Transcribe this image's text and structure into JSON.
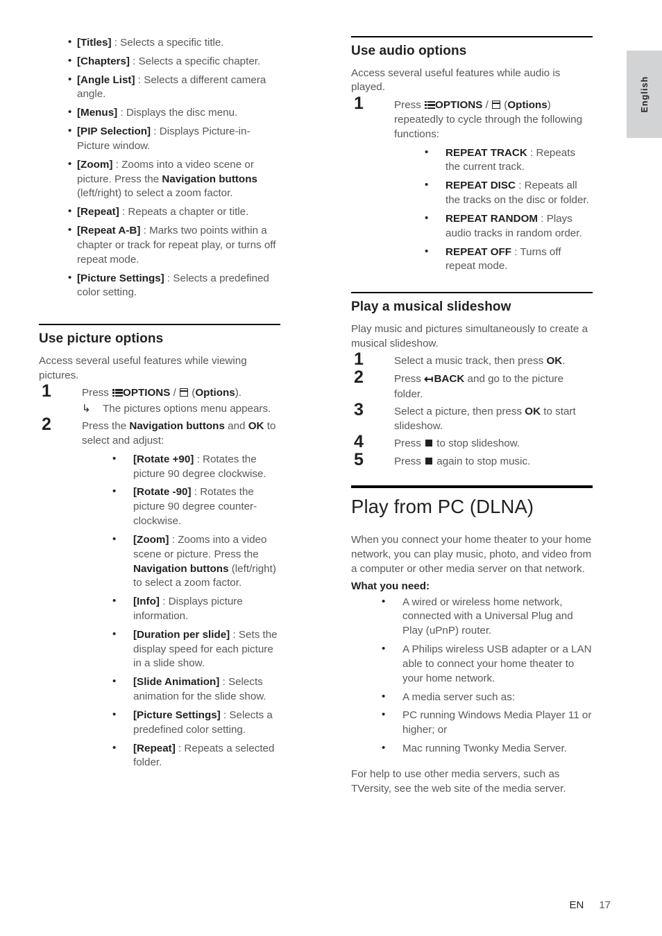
{
  "page": {
    "language_tab": "English",
    "footer_language_code": "EN",
    "footer_page_number": "17"
  },
  "left_column": {
    "video_options_bullets": [
      {
        "term": "[Titles]",
        "desc": " : Selects a specific title."
      },
      {
        "term": "[Chapters]",
        "desc": " : Selects a specific chapter."
      },
      {
        "term": "[Angle List]",
        "desc": " : Selects a different camera angle."
      },
      {
        "term": "[Menus]",
        "desc": " : Displays the disc menu."
      },
      {
        "term": "[PIP Selection]",
        "desc": " : Displays Picture-in-Picture window."
      },
      {
        "term": "[Zoom]",
        "desc_pre": " : Zooms into a video scene or picture. Press the ",
        "emphasis": "Navigation buttons",
        "desc_post": " (left/right) to select a zoom factor."
      },
      {
        "term": "[Repeat]",
        "desc": " : Repeats a chapter or title."
      },
      {
        "term": "[Repeat A-B]",
        "desc": " : Marks two points within a chapter or track for repeat play, or turns off repeat mode."
      },
      {
        "term": "[Picture Settings]",
        "desc": " : Selects a predefined color setting."
      }
    ],
    "picture_options": {
      "heading": "Use picture options",
      "intro": "Access several useful features while viewing pictures.",
      "step1_pre": "Press ",
      "step1_options_label": "OPTIONS",
      "step1_mid": " / ",
      "step1_paren_open": " (",
      "step1_options_word": "Options",
      "step1_paren_close": ").",
      "step1_sub": "The pictures options menu appears.",
      "step2_pre": "Press the ",
      "step2_nav": "Navigation buttons",
      "step2_mid": " and ",
      "step2_ok": "OK",
      "step2_post": " to select and adjust:",
      "bullets": [
        {
          "term": "[Rotate +90]",
          "desc": " : Rotates the picture 90 degree clockwise."
        },
        {
          "term": "[Rotate -90]",
          "desc": " : Rotates the picture 90 degree counter-clockwise."
        },
        {
          "term": "[Zoom]",
          "desc_pre": " : Zooms into a video scene or picture. Press the ",
          "emphasis": "Navigation buttons",
          "desc_post": " (left/right) to select a zoom factor."
        },
        {
          "term": "[Info]",
          "desc": " : Displays picture information."
        },
        {
          "term": "[Duration per slide]",
          "desc": " : Sets the display speed for each picture in a slide show."
        },
        {
          "term": "[Slide Animation]",
          "desc": " : Selects animation for the slide show."
        },
        {
          "term": "[Picture Settings]",
          "desc": " : Selects a predefined color setting."
        },
        {
          "term": "[Repeat]",
          "desc": " : Repeats a selected folder."
        }
      ]
    }
  },
  "right_column": {
    "audio_options": {
      "heading": "Use audio options",
      "intro": "Access several useful features while audio is played.",
      "step1_pre": "Press ",
      "step1_options_label": "OPTIONS",
      "step1_mid": " / ",
      "step1_paren_open": " (",
      "step1_options_word": "Options",
      "step1_paren_close": ")",
      "step1_post": " repeatedly to cycle through the following functions:",
      "bullets": [
        {
          "term": "REPEAT TRACK",
          "desc": " : Repeats the current track."
        },
        {
          "term": "REPEAT DISC",
          "desc": " : Repeats all the tracks on the disc or folder."
        },
        {
          "term": "REPEAT RANDOM",
          "desc": " : Plays audio tracks in random order."
        },
        {
          "term": "REPEAT OFF",
          "desc": " : Turns off repeat mode."
        }
      ]
    },
    "musical_slideshow": {
      "heading": "Play a musical slideshow",
      "intro": "Play music and pictures simultaneously to create a musical slideshow.",
      "steps": [
        {
          "pre": "Select a music track, then press ",
          "kbd": "OK",
          "post": "."
        },
        {
          "pre": "Press ",
          "icon": "back-icon",
          "kbd": "BACK",
          "post": " and go to the picture folder."
        },
        {
          "pre": "Select a picture, then press ",
          "kbd": "OK",
          "post": " to start slideshow."
        },
        {
          "pre": "Press ",
          "icon": "stop-icon",
          "post": " to stop slideshow."
        },
        {
          "pre": "Press ",
          "icon": "stop-icon",
          "post": " again to stop music."
        }
      ]
    },
    "play_from_pc": {
      "heading": "Play from PC (DLNA)",
      "intro": "When you connect your home theater to your home network, you can play music, photo, and video from a computer or other media server on that network.",
      "what_you_need_label": "What you need:",
      "requirements": [
        "A wired or wireless home network, connected with a Universal Plug and Play (uPnP) router.",
        "A Philips wireless USB adapter or a LAN able to connect your home theater to your home network.",
        "A media server such as:",
        "PC running Windows Media Player 11 or higher; or",
        "Mac running Twonky Media Server."
      ],
      "closing": "For help to use other media servers, such as TVersity, see the web site of the media server."
    }
  }
}
